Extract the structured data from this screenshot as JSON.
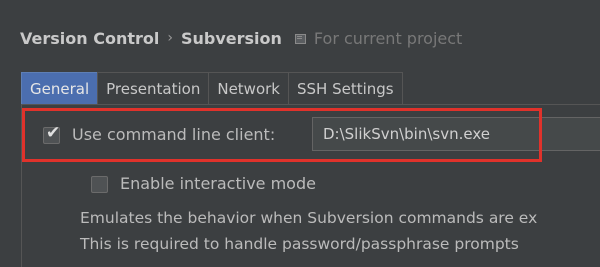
{
  "breadcrumb": {
    "items": [
      "Version Control",
      "Subversion"
    ],
    "separator": "›",
    "scope_label": "For current project",
    "scope_icon": "project-scope-icon"
  },
  "tabs": [
    {
      "label": "General",
      "active": true
    },
    {
      "label": "Presentation",
      "active": false
    },
    {
      "label": "Network",
      "active": false
    },
    {
      "label": "SSH Settings",
      "active": false
    }
  ],
  "general": {
    "use_command_line_client": {
      "label": "Use command line client:",
      "checked": true
    },
    "client_path": "D:\\SlikSvn\\bin\\svn.exe",
    "enable_interactive_mode": {
      "label": "Enable interactive mode",
      "checked": false
    },
    "description_lines": [
      "Emulates the behavior when Subversion commands are ex",
      "This is required to handle password/passphrase prompts"
    ]
  },
  "colors": {
    "background": "#3c3f41",
    "active_tab": "#4b6eaf",
    "highlight": "#e0322b",
    "text": "#bbbbbb"
  }
}
